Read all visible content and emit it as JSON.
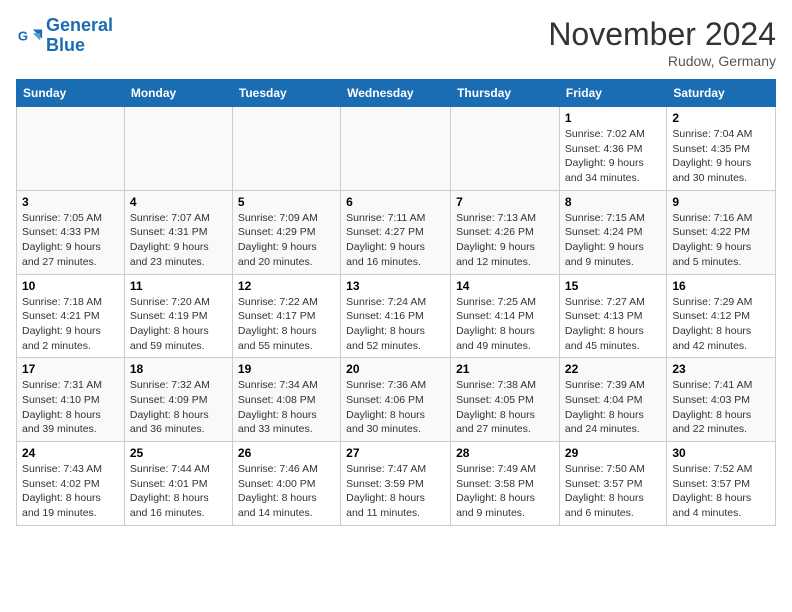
{
  "logo": {
    "line1": "General",
    "line2": "Blue"
  },
  "title": "November 2024",
  "subtitle": "Rudow, Germany",
  "headers": [
    "Sunday",
    "Monday",
    "Tuesday",
    "Wednesday",
    "Thursday",
    "Friday",
    "Saturday"
  ],
  "weeks": [
    [
      {
        "day": "",
        "info": ""
      },
      {
        "day": "",
        "info": ""
      },
      {
        "day": "",
        "info": ""
      },
      {
        "day": "",
        "info": ""
      },
      {
        "day": "",
        "info": ""
      },
      {
        "day": "1",
        "info": "Sunrise: 7:02 AM\nSunset: 4:36 PM\nDaylight: 9 hours\nand 34 minutes."
      },
      {
        "day": "2",
        "info": "Sunrise: 7:04 AM\nSunset: 4:35 PM\nDaylight: 9 hours\nand 30 minutes."
      }
    ],
    [
      {
        "day": "3",
        "info": "Sunrise: 7:05 AM\nSunset: 4:33 PM\nDaylight: 9 hours\nand 27 minutes."
      },
      {
        "day": "4",
        "info": "Sunrise: 7:07 AM\nSunset: 4:31 PM\nDaylight: 9 hours\nand 23 minutes."
      },
      {
        "day": "5",
        "info": "Sunrise: 7:09 AM\nSunset: 4:29 PM\nDaylight: 9 hours\nand 20 minutes."
      },
      {
        "day": "6",
        "info": "Sunrise: 7:11 AM\nSunset: 4:27 PM\nDaylight: 9 hours\nand 16 minutes."
      },
      {
        "day": "7",
        "info": "Sunrise: 7:13 AM\nSunset: 4:26 PM\nDaylight: 9 hours\nand 12 minutes."
      },
      {
        "day": "8",
        "info": "Sunrise: 7:15 AM\nSunset: 4:24 PM\nDaylight: 9 hours\nand 9 minutes."
      },
      {
        "day": "9",
        "info": "Sunrise: 7:16 AM\nSunset: 4:22 PM\nDaylight: 9 hours\nand 5 minutes."
      }
    ],
    [
      {
        "day": "10",
        "info": "Sunrise: 7:18 AM\nSunset: 4:21 PM\nDaylight: 9 hours\nand 2 minutes."
      },
      {
        "day": "11",
        "info": "Sunrise: 7:20 AM\nSunset: 4:19 PM\nDaylight: 8 hours\nand 59 minutes."
      },
      {
        "day": "12",
        "info": "Sunrise: 7:22 AM\nSunset: 4:17 PM\nDaylight: 8 hours\nand 55 minutes."
      },
      {
        "day": "13",
        "info": "Sunrise: 7:24 AM\nSunset: 4:16 PM\nDaylight: 8 hours\nand 52 minutes."
      },
      {
        "day": "14",
        "info": "Sunrise: 7:25 AM\nSunset: 4:14 PM\nDaylight: 8 hours\nand 49 minutes."
      },
      {
        "day": "15",
        "info": "Sunrise: 7:27 AM\nSunset: 4:13 PM\nDaylight: 8 hours\nand 45 minutes."
      },
      {
        "day": "16",
        "info": "Sunrise: 7:29 AM\nSunset: 4:12 PM\nDaylight: 8 hours\nand 42 minutes."
      }
    ],
    [
      {
        "day": "17",
        "info": "Sunrise: 7:31 AM\nSunset: 4:10 PM\nDaylight: 8 hours\nand 39 minutes."
      },
      {
        "day": "18",
        "info": "Sunrise: 7:32 AM\nSunset: 4:09 PM\nDaylight: 8 hours\nand 36 minutes."
      },
      {
        "day": "19",
        "info": "Sunrise: 7:34 AM\nSunset: 4:08 PM\nDaylight: 8 hours\nand 33 minutes."
      },
      {
        "day": "20",
        "info": "Sunrise: 7:36 AM\nSunset: 4:06 PM\nDaylight: 8 hours\nand 30 minutes."
      },
      {
        "day": "21",
        "info": "Sunrise: 7:38 AM\nSunset: 4:05 PM\nDaylight: 8 hours\nand 27 minutes."
      },
      {
        "day": "22",
        "info": "Sunrise: 7:39 AM\nSunset: 4:04 PM\nDaylight: 8 hours\nand 24 minutes."
      },
      {
        "day": "23",
        "info": "Sunrise: 7:41 AM\nSunset: 4:03 PM\nDaylight: 8 hours\nand 22 minutes."
      }
    ],
    [
      {
        "day": "24",
        "info": "Sunrise: 7:43 AM\nSunset: 4:02 PM\nDaylight: 8 hours\nand 19 minutes."
      },
      {
        "day": "25",
        "info": "Sunrise: 7:44 AM\nSunset: 4:01 PM\nDaylight: 8 hours\nand 16 minutes."
      },
      {
        "day": "26",
        "info": "Sunrise: 7:46 AM\nSunset: 4:00 PM\nDaylight: 8 hours\nand 14 minutes."
      },
      {
        "day": "27",
        "info": "Sunrise: 7:47 AM\nSunset: 3:59 PM\nDaylight: 8 hours\nand 11 minutes."
      },
      {
        "day": "28",
        "info": "Sunrise: 7:49 AM\nSunset: 3:58 PM\nDaylight: 8 hours\nand 9 minutes."
      },
      {
        "day": "29",
        "info": "Sunrise: 7:50 AM\nSunset: 3:57 PM\nDaylight: 8 hours\nand 6 minutes."
      },
      {
        "day": "30",
        "info": "Sunrise: 7:52 AM\nSunset: 3:57 PM\nDaylight: 8 hours\nand 4 minutes."
      }
    ]
  ]
}
